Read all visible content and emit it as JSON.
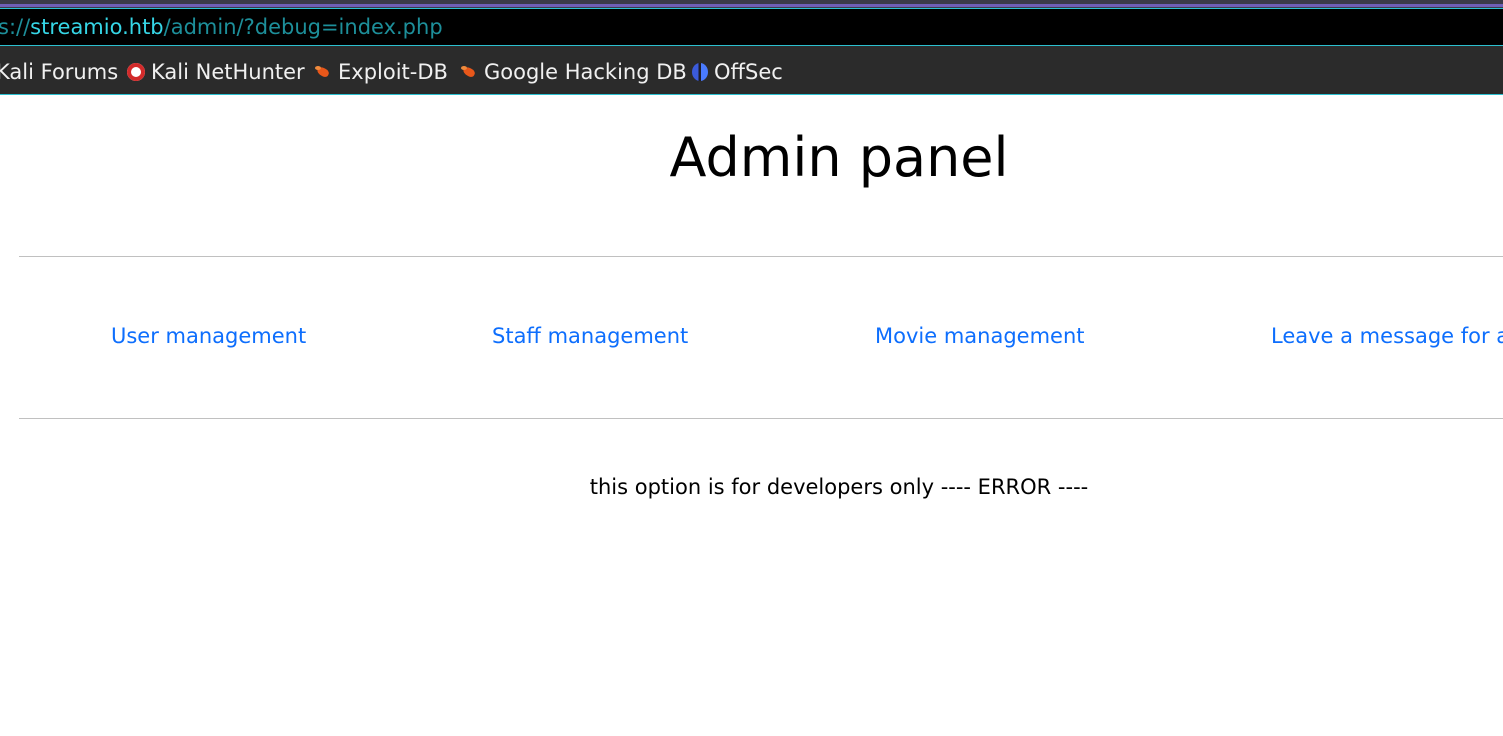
{
  "browser": {
    "url": {
      "scheme": "s://",
      "host": "streamio.htb",
      "path": "/admin/?debug=index.php"
    },
    "bookmarks": [
      {
        "label": "Kali Forums",
        "icon": "none"
      },
      {
        "label": "Kali NetHunter",
        "icon": "nethunter-icon"
      },
      {
        "label": "Exploit-DB",
        "icon": "exploit-db-icon"
      },
      {
        "label": "Google Hacking DB",
        "icon": "exploit-db-icon"
      },
      {
        "label": "OffSec",
        "icon": "offsec-icon"
      }
    ]
  },
  "page": {
    "title": "Admin panel",
    "nav": [
      {
        "label": "User management"
      },
      {
        "label": "Staff management"
      },
      {
        "label": "Movie management"
      },
      {
        "label": "Leave a message for a"
      }
    ],
    "message": "this option is for developers only ---- ERROR ----"
  },
  "colors": {
    "link": "#0d6efd",
    "url_host": "#36d6e6",
    "url_dim": "#1d8f9a",
    "toolbar_bg": "#2b2b2b"
  }
}
